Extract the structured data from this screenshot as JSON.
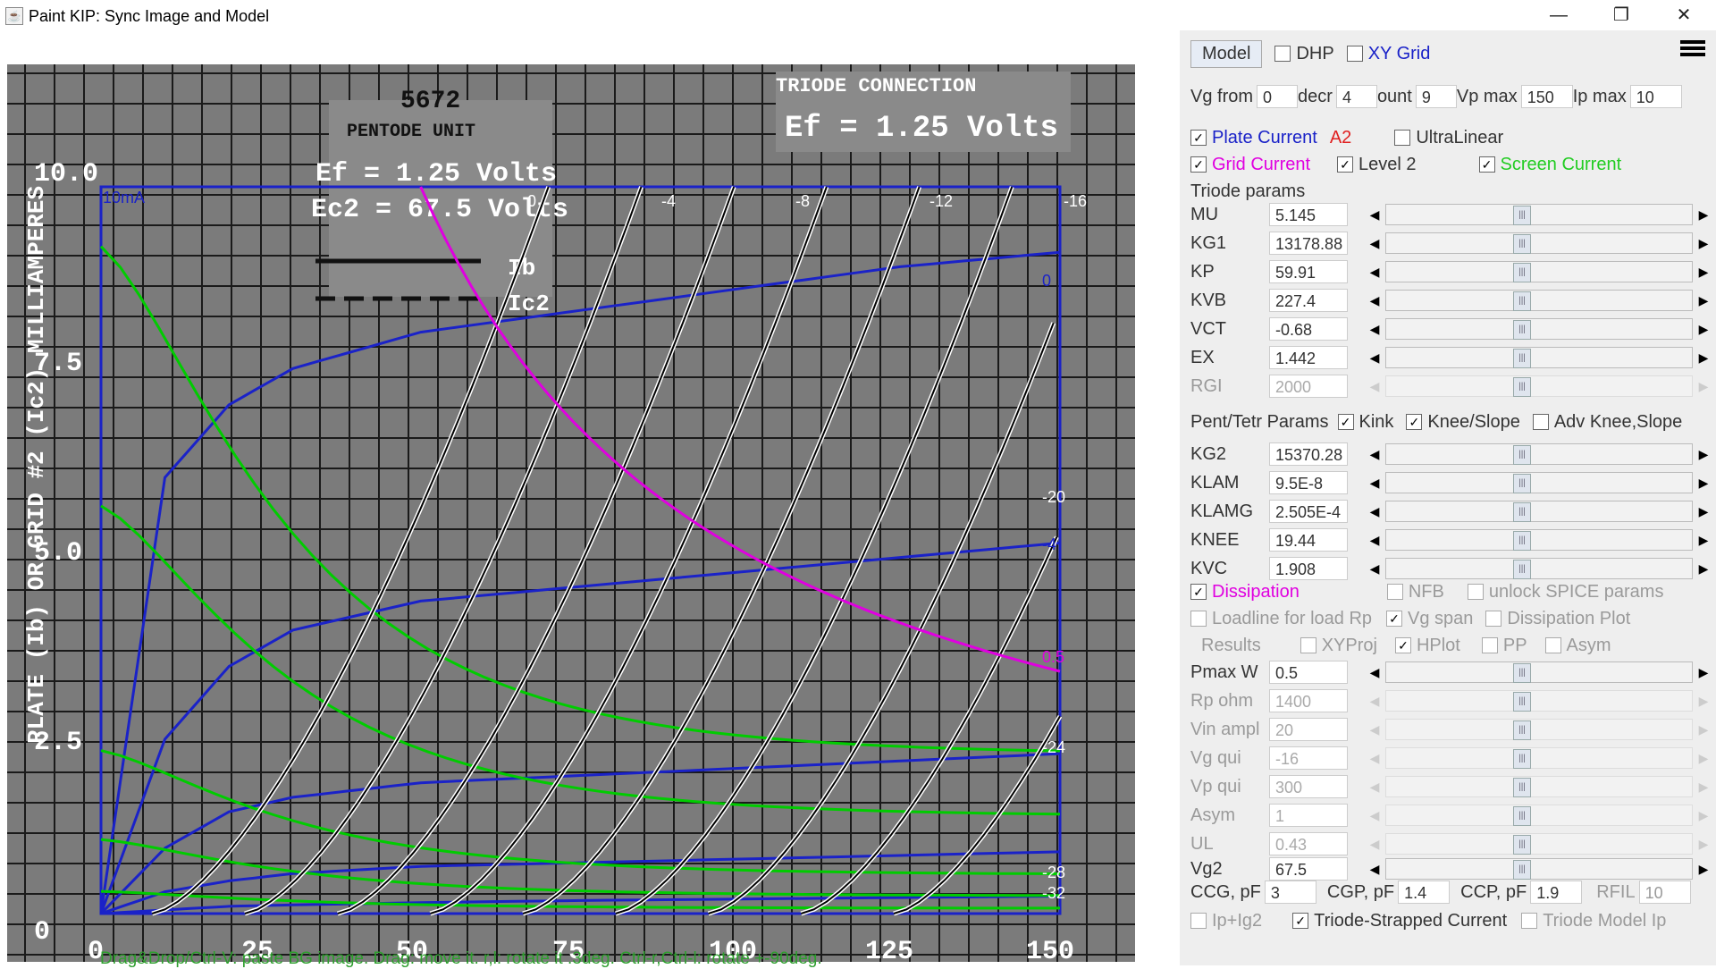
{
  "window": {
    "title": "Paint KIP: Sync Image and Model",
    "minimize": "—",
    "restore": "❐",
    "close": "✕"
  },
  "status_bar": {
    "hint": "Drag&Drop/Ctrl-V: paste BG image. Drag: move it. r,l: rotate it .3deg. Ctrl-r,Ctrl-l: rotate +-90deg."
  },
  "background_image": {
    "tube_name": "5672",
    "unit": "PENTODE UNIT",
    "ef_label": "Ef = 1.25 Volts",
    "ec2_label": "Ec2 = 67.5 Volts",
    "triode_label": "TRIODE CONNECTION",
    "triode_ef": "Ef = 1.25 Volts",
    "ylabel": "PLATE (Ib) OR GRID #2 (Ic2) MILLIAMPERES",
    "ib_legend": "Ib",
    "ic2_legend": "Ic2",
    "y_ticks": [
      "10.0",
      "7.5",
      "5.0",
      "2.5",
      "0"
    ],
    "x_ticks": [
      "0",
      "25",
      "50",
      "75",
      "100",
      "125",
      "150"
    ]
  },
  "plot_overlay": {
    "corner_label": "10mA",
    "vg_labels_top": [
      "0",
      "-4",
      "-8",
      "-12",
      "-16"
    ],
    "right_labels": [
      "0",
      "-4",
      "-20",
      "0.5",
      "-24",
      "-28",
      "-32"
    ],
    "accent_blue": "#1a22c8",
    "accent_green": "#00cc00",
    "accent_magenta": "#e000e0"
  },
  "chart_data": {
    "type": "line",
    "xlabel": "",
    "ylabel": "PLATE (Ib) OR GRID #2 (Ic2) MILLIAMPERES",
    "xlim": [
      0,
      150
    ],
    "ylim": [
      0,
      10
    ],
    "x": [
      0,
      10,
      20,
      30,
      50,
      75,
      100,
      125,
      150
    ],
    "series": [
      {
        "name": "0",
        "values": [
          0,
          6.0,
          7.0,
          7.5,
          8.0,
          8.3,
          8.6,
          8.9,
          9.1
        ]
      },
      {
        "name": "-4",
        "values": [
          0,
          2.4,
          3.4,
          3.9,
          4.3,
          4.5,
          4.7,
          4.9,
          5.1
        ]
      },
      {
        "name": "-8",
        "values": [
          0,
          0.9,
          1.4,
          1.6,
          1.8,
          1.9,
          2.0,
          2.1,
          2.2
        ]
      },
      {
        "name": "-12",
        "values": [
          0,
          0.3,
          0.45,
          0.55,
          0.65,
          0.7,
          0.75,
          0.8,
          0.85
        ]
      },
      {
        "name": "-16",
        "values": [
          0,
          0.05,
          0.1,
          0.12,
          0.15,
          0.18,
          0.2,
          0.22,
          0.24
        ]
      }
    ]
  },
  "panel": {
    "model_button": "Model",
    "dhp": "DHP",
    "xy_grid": "XY Grid",
    "vg_from_label": "Vg from",
    "vg_from": "0",
    "decr_label": "decr",
    "decr": "4",
    "count_label": "ount",
    "count": "9",
    "vp_max_label": "Vp max",
    "vp_max": "150",
    "ip_max_label": "Ip max",
    "ip_max": "10",
    "plate_current": "Plate Current",
    "a2": "A2",
    "ultralinear": "UltraLinear",
    "grid_current": "Grid Current",
    "level2": "Level 2",
    "screen_current": "Screen Current",
    "triode_params": "Triode params",
    "triode": [
      {
        "name": "MU",
        "value": "5.145"
      },
      {
        "name": "KG1",
        "value": "13178.88"
      },
      {
        "name": "KP",
        "value": "59.91"
      },
      {
        "name": "KVB",
        "value": "227.4"
      },
      {
        "name": "VCT",
        "value": "-0.68"
      },
      {
        "name": "EX",
        "value": "1.442"
      },
      {
        "name": "RGI",
        "value": "2000"
      }
    ],
    "pent_params": "Pent/Tetr Params",
    "kink": "Kink",
    "knee_slope": "Knee/Slope",
    "adv_knee": "Adv Knee,Slope",
    "pent": [
      {
        "name": "KG2",
        "value": "15370.28"
      },
      {
        "name": "KLAM",
        "value": "9.5E-8"
      },
      {
        "name": "KLAMG",
        "value": "2.505E-4"
      },
      {
        "name": "KNEE",
        "value": "19.44"
      },
      {
        "name": "KVC",
        "value": "1.908"
      }
    ],
    "dissipation": "Dissipation",
    "nfb": "NFB",
    "unlock_spice": "unlock SPICE params",
    "loadline": "Loadline for load Rp",
    "vg_span": "Vg span",
    "dissipation_plot": "Dissipation Plot",
    "results": "Results",
    "xyproj": "XYProj",
    "hplot": "HPlot",
    "pp": "PP",
    "asym": "Asym",
    "pmax": {
      "name": "Pmax W",
      "value": "0.5"
    },
    "extra": [
      {
        "name": "Rp ohm",
        "value": "1400"
      },
      {
        "name": "Vin ampl",
        "value": "20"
      },
      {
        "name": "Vg qui",
        "value": "-16"
      },
      {
        "name": "Vp qui",
        "value": "300"
      },
      {
        "name": "Asym",
        "value": "1"
      },
      {
        "name": "UL",
        "value": "0.43"
      }
    ],
    "vg2": {
      "name": "Vg2",
      "value": "67.5"
    },
    "ccg_label": "CCG, pF",
    "ccg": "3",
    "cgp_label": "CGP, pF",
    "cgp": "1.4",
    "ccp_label": "CCP, pF",
    "ccp": "1.9",
    "rfil_label": "RFIL",
    "rfil": "10",
    "ip_ig2": "Ip+Ig2",
    "triode_strapped": "Triode-Strapped Current",
    "triode_model_ip": "Triode Model Ip"
  }
}
